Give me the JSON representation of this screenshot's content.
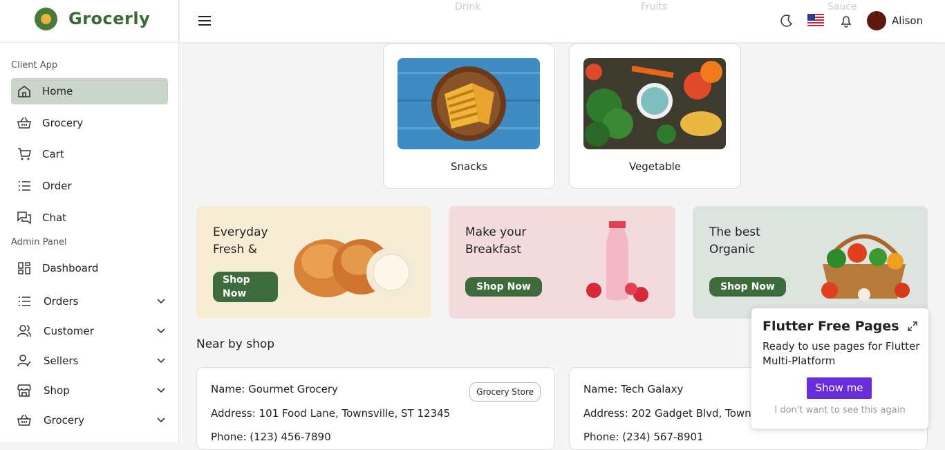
{
  "brand": {
    "name": "Grocerly",
    "color": "#3a6b34"
  },
  "sidebar": {
    "client_section": "Client App",
    "admin_section": "Admin Panel",
    "client_items": [
      {
        "label": "Home",
        "icon": "home-icon"
      },
      {
        "label": "Grocery",
        "icon": "basket-icon"
      },
      {
        "label": "Cart",
        "icon": "cart-icon"
      },
      {
        "label": "Order",
        "icon": "list-icon"
      },
      {
        "label": "Chat",
        "icon": "chat-icon"
      }
    ],
    "admin_items": [
      {
        "label": "Dashboard",
        "icon": "grid-icon"
      },
      {
        "label": "Orders",
        "icon": "list-icon"
      },
      {
        "label": "Customer",
        "icon": "users-icon"
      },
      {
        "label": "Sellers",
        "icon": "user-check-icon"
      },
      {
        "label": "Shop",
        "icon": "store-icon"
      },
      {
        "label": "Grocery",
        "icon": "basket-icon"
      }
    ]
  },
  "topbar": {
    "user_name": "Alison",
    "ghost_labels": [
      "Drink",
      "Fruits",
      "Sauce"
    ]
  },
  "categories": [
    {
      "name": "Snacks"
    },
    {
      "name": "Vegetable"
    }
  ],
  "promos": [
    {
      "title": "Everyday Fresh &",
      "button": "Shop Now",
      "bg": "#f7ecd4"
    },
    {
      "title": "Make your Breakfast",
      "button": "Shop Now",
      "bg": "#f2dadd"
    },
    {
      "title": "The best Organic",
      "button": "Shop Now",
      "bg": "#dde3de"
    }
  ],
  "nearby": {
    "heading": "Near by shop",
    "shops": [
      {
        "name": "Name: Gourmet Grocery",
        "address": "Address: 101 Food Lane, Townsville, ST 12345",
        "phone": "Phone: (123) 456-7890",
        "tag": "Grocery Store"
      },
      {
        "name": "Name: Tech Galaxy",
        "address": "Address: 202 Gadget Blvd, Towns",
        "phone": "Phone: (234) 567-8901"
      }
    ]
  },
  "popup": {
    "title": "Flutter Free Pages",
    "desc": "Ready to use pages for Flutter Multi-Platform",
    "button": "Show me",
    "dismiss": "I don't want to see this again",
    "button_color": "#6a2ddc"
  }
}
